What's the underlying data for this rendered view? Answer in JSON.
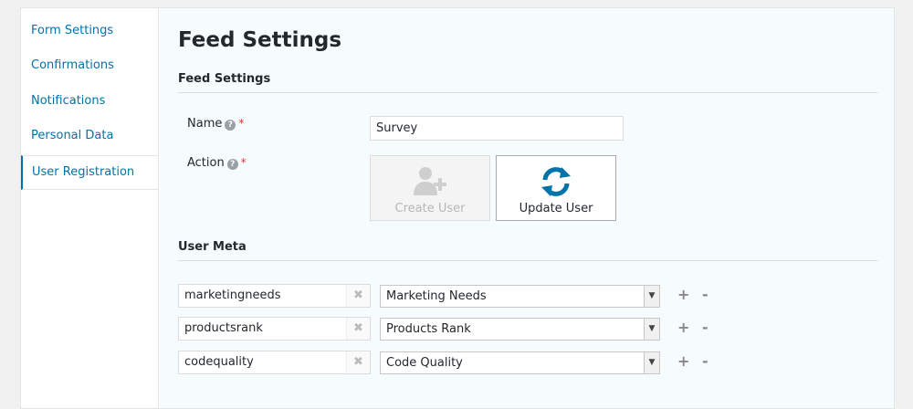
{
  "sidebar": {
    "items": [
      {
        "label": "Form Settings"
      },
      {
        "label": "Confirmations"
      },
      {
        "label": "Notifications"
      },
      {
        "label": "Personal Data"
      },
      {
        "label": "User Registration"
      }
    ]
  },
  "page": {
    "title": "Feed Settings",
    "section_feed": "Feed Settings",
    "section_meta": "User Meta"
  },
  "fields": {
    "name_label": "Name",
    "name_value": "Survey",
    "action_label": "Action",
    "help_icon": "?",
    "required_mark": "*"
  },
  "actions": {
    "create_label": "Create User",
    "update_label": "Update User"
  },
  "meta": {
    "clear_icon": "✖",
    "arrow_icon": "▼",
    "plus": "+",
    "minus": "-",
    "rows": [
      {
        "key": "marketingneeds",
        "field": "Marketing Needs"
      },
      {
        "key": "productsrank",
        "field": "Products Rank"
      },
      {
        "key": "codequality",
        "field": "Code Quality"
      }
    ]
  },
  "colors": {
    "link": "#0073aa",
    "required": "#d63638",
    "sync_icon": "#0073aa"
  }
}
